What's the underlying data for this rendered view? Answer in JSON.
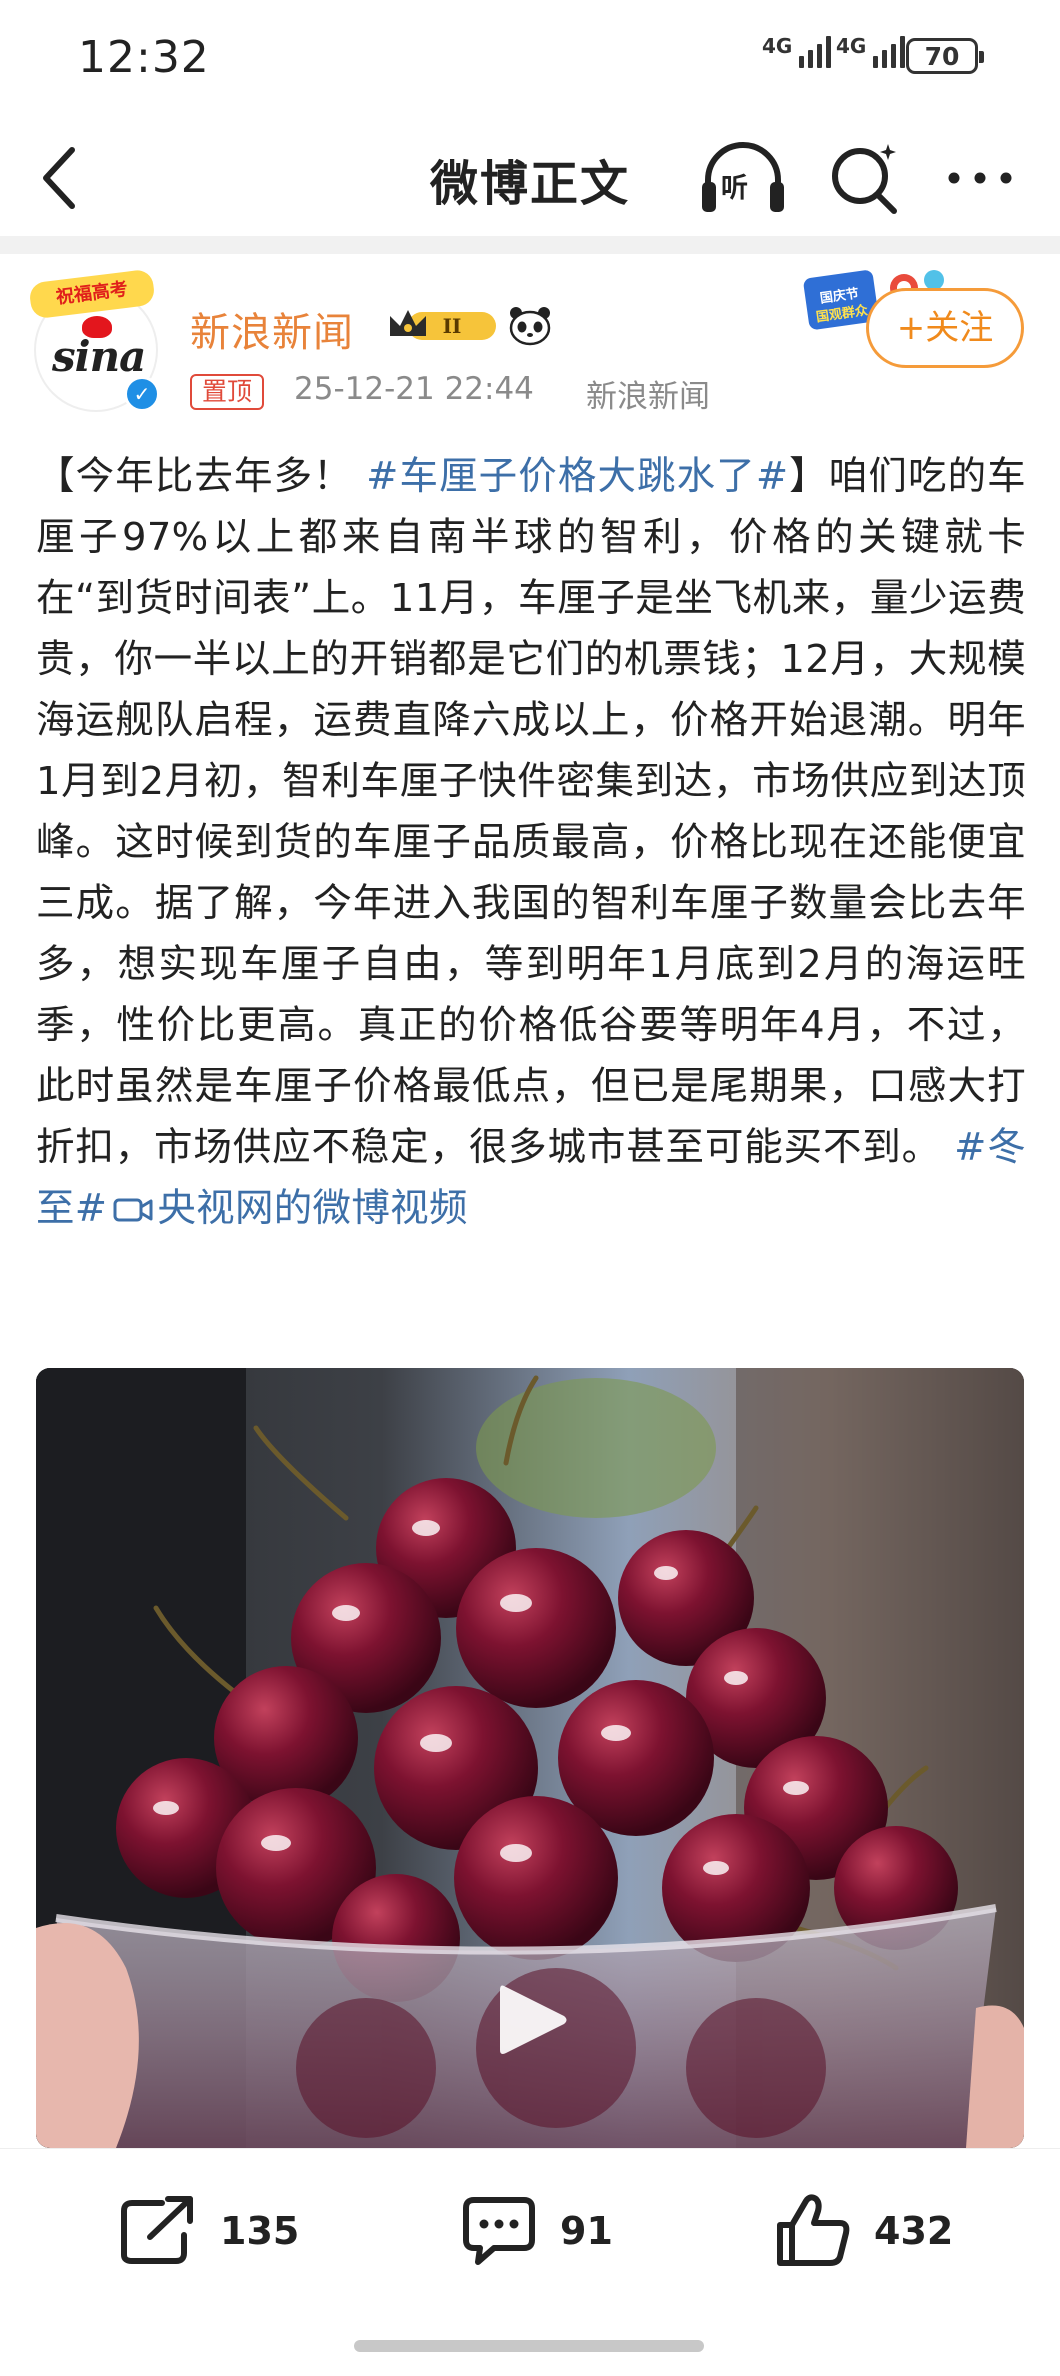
{
  "status_bar": {
    "time": "12:32",
    "signal_1": "4G",
    "signal_2": "4G",
    "battery": "70"
  },
  "nav": {
    "title": "微博正文",
    "listen_label": "听",
    "icons": [
      "back-arrow-icon",
      "headphones-icon",
      "search-icon",
      "more-icon"
    ]
  },
  "author": {
    "avatar_banner": "祝福高考",
    "avatar_logo": "sina",
    "name": "新浪新闻",
    "level_badge": "II",
    "pinned_tag": "置顶",
    "timestamp": "25-12-21 22:44",
    "source": "新浪新闻",
    "festival_sticker": "国庆节 国观群众",
    "follow_label": "+关注"
  },
  "post": {
    "bracket_open": "【今年比去年多！ ",
    "headline_topic": "#车厘子价格大跳水了#",
    "body": "】咱们吃的车厘子97%以上都来自南半球的智利，价格的关键就卡在“到货时间表”上。11月，车厘子是坐飞机来，量少运费贵，你一半以上的开销都是它们的机票钱；12月，大规模海运舰队启程，运费直降六成以上，价格开始退潮。明年1月到2月初，智利车厘子快件密集到达，市场供应到达顶峰。这时候到货的车厘子品质最高，价格比现在还能便宜三成。据了解，今年进入我国的智利车厘子数量会比去年多，想实现车厘子自由，等到明年1月底到2月的海运旺季，性价比更高。真正的价格低谷要等明年4月，不过，此时虽然是车厘子价格最低点，但已是尾期果，口感大打折扣，市场供应不稳定，很多城市甚至可能买不到。 ",
    "tail_topic": "#冬至#",
    "video_link": "央视网的微博视频"
  },
  "video": {
    "subject": "cherries-in-glass-bowl"
  },
  "actions": {
    "repost_count": "135",
    "comment_count": "91",
    "like_count": "432"
  },
  "colors": {
    "accent_orange": "#f08a1c",
    "topic_blue": "#3d6fa8",
    "pin_red": "#e04a3a",
    "meta_gray": "#8a8a8a"
  }
}
